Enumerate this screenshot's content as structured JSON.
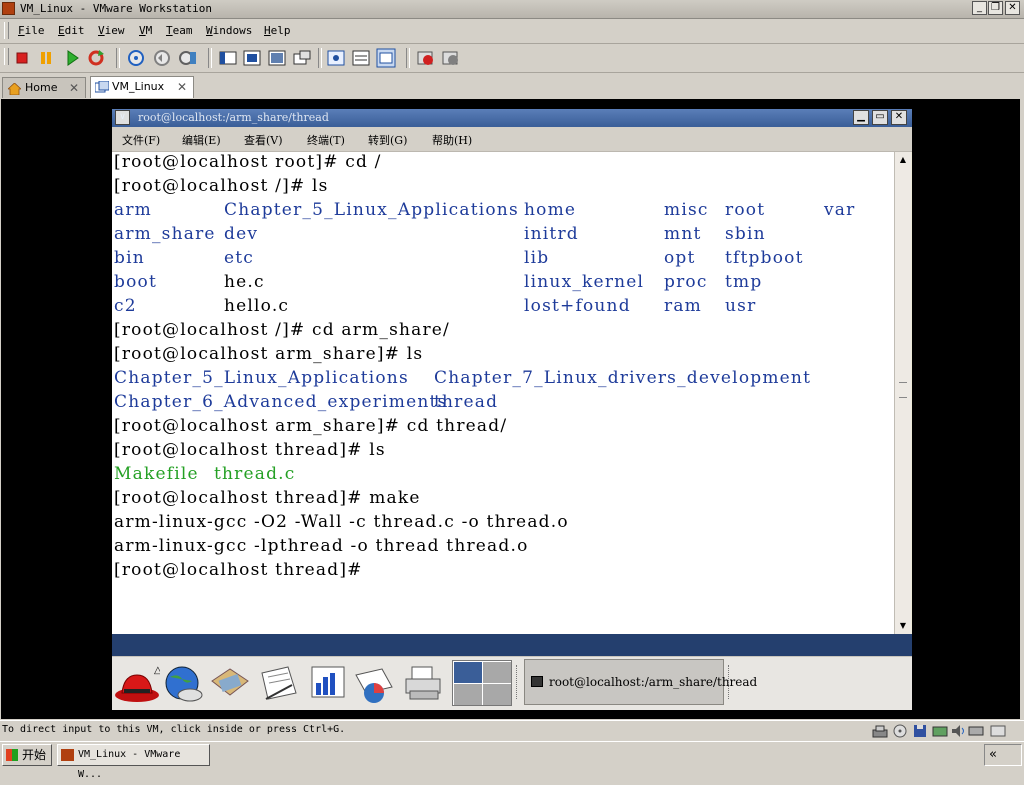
{
  "app": {
    "title": "VM_Linux - VMware Workstation"
  },
  "window_buttons": {
    "minimize": "_",
    "restore": "❐",
    "close": "✕"
  },
  "menu": {
    "items": [
      {
        "label": "File",
        "accel": "F"
      },
      {
        "label": "Edit",
        "accel": "E"
      },
      {
        "label": "View",
        "accel": "V"
      },
      {
        "label": "VM",
        "accel": "M"
      },
      {
        "label": "Team",
        "accel": "T"
      },
      {
        "label": "Windows",
        "accel": "W"
      },
      {
        "label": "Help",
        "accel": "H"
      }
    ]
  },
  "toolbar": {
    "buttons": [
      "power-off",
      "suspend",
      "power-on",
      "reset",
      "snapshot",
      "revert-snapshot",
      "snapshot-manager",
      "quick-switch",
      "full-screen",
      "summary-view",
      "console-view",
      "appliance-view",
      "team",
      "clone"
    ]
  },
  "tabs": [
    {
      "label": "Home",
      "close": "✕",
      "active": false
    },
    {
      "label": "VM_Linux",
      "close": "✕",
      "active": true
    }
  ],
  "terminal": {
    "title": "root@localhost:/arm_share/thread",
    "menu_btn": "∨",
    "title_buttons": {
      "minimize": "▁",
      "maximize": "▭",
      "close": "✕"
    },
    "menu": [
      "文件(F)",
      "编辑(E)",
      "查看(V)",
      "终端(T)",
      "转到(G)",
      "帮助(H)"
    ],
    "lines": [
      {
        "segments": [
          {
            "text": "[root@localhost root]# cd /",
            "color": "default"
          }
        ]
      },
      {
        "segments": [
          {
            "text": "[root@localhost /]# ls",
            "color": "default"
          }
        ]
      },
      {
        "segments": [
          {
            "text": "arm",
            "color": "blue",
            "col": 0
          },
          {
            "text": "Chapter_5_Linux_Applications",
            "color": "blue",
            "col": 1
          },
          {
            "text": "home",
            "color": "blue",
            "col": 2
          },
          {
            "text": "misc",
            "color": "blue",
            "col": 3
          },
          {
            "text": "root",
            "color": "blue",
            "col": 4
          },
          {
            "text": "var",
            "color": "blue",
            "col": 5
          }
        ]
      },
      {
        "segments": [
          {
            "text": "arm_share",
            "color": "blue",
            "col": 0
          },
          {
            "text": "dev",
            "color": "blue",
            "col": 1
          },
          {
            "text": "initrd",
            "color": "blue",
            "col": 2
          },
          {
            "text": "mnt",
            "color": "blue",
            "col": 3
          },
          {
            "text": "sbin",
            "color": "blue",
            "col": 4
          }
        ]
      },
      {
        "segments": [
          {
            "text": "bin",
            "color": "blue",
            "col": 0
          },
          {
            "text": "etc",
            "color": "blue",
            "col": 1
          },
          {
            "text": "lib",
            "color": "blue",
            "col": 2
          },
          {
            "text": "opt",
            "color": "blue",
            "col": 3
          },
          {
            "text": "tftpboot",
            "color": "blue",
            "col": 4
          }
        ]
      },
      {
        "segments": [
          {
            "text": "boot",
            "color": "blue",
            "col": 0
          },
          {
            "text": "he.c",
            "color": "default",
            "col": 1
          },
          {
            "text": "linux_kernel",
            "color": "blue",
            "col": 2
          },
          {
            "text": "proc",
            "color": "blue",
            "col": 3
          },
          {
            "text": "tmp",
            "color": "blue",
            "col": 4
          }
        ]
      },
      {
        "segments": [
          {
            "text": "c2",
            "color": "blue",
            "col": 0
          },
          {
            "text": "hello.c",
            "color": "default",
            "col": 1
          },
          {
            "text": "lost+found",
            "color": "blue",
            "col": 2
          },
          {
            "text": "ram",
            "color": "blue",
            "col": 3
          },
          {
            "text": "usr",
            "color": "blue",
            "col": 4
          }
        ]
      },
      {
        "segments": [
          {
            "text": "[root@localhost /]# cd arm_share/",
            "color": "default"
          }
        ]
      },
      {
        "segments": [
          {
            "text": "[root@localhost arm_share]# ls",
            "color": "default"
          }
        ]
      },
      {
        "segments": [
          {
            "text": "Chapter_5_Linux_Applications",
            "color": "blue",
            "col": 6
          },
          {
            "text": "Chapter_7_Linux_drivers_development",
            "color": "blue",
            "col": 7
          }
        ]
      },
      {
        "segments": [
          {
            "text": "Chapter_6_Advanced_experiments",
            "color": "blue",
            "col": 6
          },
          {
            "text": "thread",
            "color": "blue",
            "col": 7
          }
        ]
      },
      {
        "segments": [
          {
            "text": "[root@localhost arm_share]# cd thread/",
            "color": "default"
          }
        ]
      },
      {
        "segments": [
          {
            "text": "[root@localhost thread]# ls",
            "color": "default"
          }
        ]
      },
      {
        "segments": [
          {
            "text": "Makefile",
            "color": "green",
            "col": 0
          },
          {
            "text": "thread.c",
            "color": "green",
            "col": 8
          }
        ]
      },
      {
        "segments": [
          {
            "text": "[root@localhost thread]# make",
            "color": "default"
          }
        ]
      },
      {
        "segments": [
          {
            "text": "arm-linux-gcc -O2 -Wall -c thread.c -o thread.o",
            "color": "default"
          }
        ]
      },
      {
        "segments": [
          {
            "text": "arm-linux-gcc -lpthread -o thread thread.o",
            "color": "default"
          }
        ]
      },
      {
        "segments": [
          {
            "text": "[root@localhost thread]#",
            "color": "default"
          }
        ]
      }
    ],
    "scroll_up": "▲",
    "scroll_down": "▼"
  },
  "gnome_panel": {
    "launchers": [
      "redhat-menu-icon",
      "web-browser-icon",
      "mail-icon",
      "writer-icon",
      "presentation-icon",
      "calc-icon",
      "printer-icon"
    ],
    "task_label": "root@localhost:/arm_share/thread"
  },
  "status_text": "To direct input to this VM, click inside or press Ctrl+G.",
  "taskbar": {
    "start_label": "开始",
    "task_label": "VM_Linux - VMware W...",
    "tray_arrow": "«"
  },
  "colors": {
    "terminal_blue": "#1e3b9a",
    "terminal_green": "#24a024",
    "titlebar_blue": "#3a5e98"
  }
}
